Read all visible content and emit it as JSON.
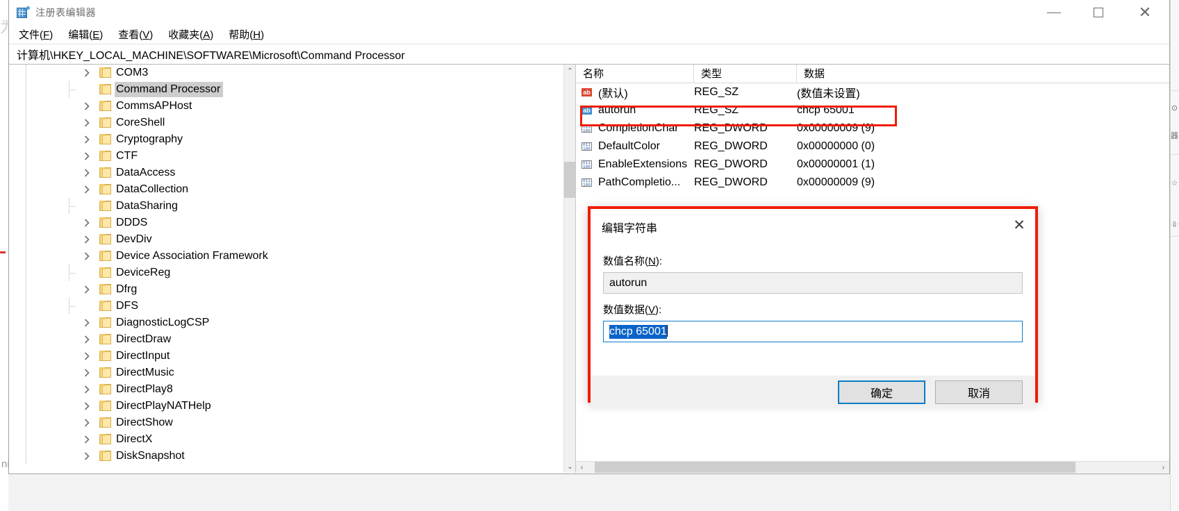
{
  "window": {
    "title": "注册表编辑器",
    "app_icon": "registry-editor-icon",
    "controls": {
      "minimize": "—",
      "maximize": "□",
      "close": "✕"
    }
  },
  "menubar": [
    {
      "label": "文件",
      "accel": "F"
    },
    {
      "label": "编辑",
      "accel": "E"
    },
    {
      "label": "查看",
      "accel": "V"
    },
    {
      "label": "收藏夹",
      "accel": "A"
    },
    {
      "label": "帮助",
      "accel": "H"
    }
  ],
  "address": "计算机\\HKEY_LOCAL_MACHINE\\SOFTWARE\\Microsoft\\Command Processor",
  "tree": {
    "items": [
      {
        "label": "COM3",
        "expandable": true,
        "selected": false
      },
      {
        "label": "Command Processor",
        "expandable": false,
        "selected": true
      },
      {
        "label": "CommsAPHost",
        "expandable": true,
        "selected": false
      },
      {
        "label": "CoreShell",
        "expandable": true,
        "selected": false
      },
      {
        "label": "Cryptography",
        "expandable": true,
        "selected": false
      },
      {
        "label": "CTF",
        "expandable": true,
        "selected": false
      },
      {
        "label": "DataAccess",
        "expandable": true,
        "selected": false
      },
      {
        "label": "DataCollection",
        "expandable": true,
        "selected": false
      },
      {
        "label": "DataSharing",
        "expandable": false,
        "selected": false
      },
      {
        "label": "DDDS",
        "expandable": true,
        "selected": false
      },
      {
        "label": "DevDiv",
        "expandable": true,
        "selected": false
      },
      {
        "label": "Device Association Framework",
        "expandable": true,
        "selected": false
      },
      {
        "label": "DeviceReg",
        "expandable": false,
        "selected": false
      },
      {
        "label": "Dfrg",
        "expandable": true,
        "selected": false
      },
      {
        "label": "DFS",
        "expandable": false,
        "selected": false
      },
      {
        "label": "DiagnosticLogCSP",
        "expandable": true,
        "selected": false
      },
      {
        "label": "DirectDraw",
        "expandable": true,
        "selected": false
      },
      {
        "label": "DirectInput",
        "expandable": true,
        "selected": false
      },
      {
        "label": "DirectMusic",
        "expandable": true,
        "selected": false
      },
      {
        "label": "DirectPlay8",
        "expandable": true,
        "selected": false
      },
      {
        "label": "DirectPlayNATHelp",
        "expandable": true,
        "selected": false
      },
      {
        "label": "DirectShow",
        "expandable": true,
        "selected": false
      },
      {
        "label": "DirectX",
        "expandable": true,
        "selected": false
      },
      {
        "label": "DiskSnapshot",
        "expandable": true,
        "selected": false
      }
    ]
  },
  "list": {
    "columns": [
      "名称",
      "类型",
      "数据"
    ],
    "rows": [
      {
        "name": "(默认)",
        "type": "REG_SZ",
        "data": "(数值未设置)",
        "icon": "string-value-icon",
        "icon_color": "#d9472f",
        "highlighted": false
      },
      {
        "name": "autorun",
        "type": "REG_SZ",
        "data": "chcp 65001",
        "icon": "string-value-icon",
        "icon_color": "#3f8fd0",
        "highlighted": true
      },
      {
        "name": "CompletionChar",
        "type": "REG_DWORD",
        "data": "0x00000009 (9)",
        "icon": "dword-value-icon",
        "icon_color": "#2a5fa8",
        "highlighted": false
      },
      {
        "name": "DefaultColor",
        "type": "REG_DWORD",
        "data": "0x00000000 (0)",
        "icon": "dword-value-icon",
        "icon_color": "#2a5fa8",
        "highlighted": false
      },
      {
        "name": "EnableExtensions",
        "type": "REG_DWORD",
        "data": "0x00000001 (1)",
        "icon": "dword-value-icon",
        "icon_color": "#2a5fa8",
        "highlighted": false
      },
      {
        "name": "PathCompletio...",
        "type": "REG_DWORD",
        "data": "0x00000009 (9)",
        "icon": "dword-value-icon",
        "icon_color": "#2a5fa8",
        "highlighted": false
      }
    ]
  },
  "dialog": {
    "title": "编辑字符串",
    "close_label": "✕",
    "name_label": "数值名称(N):",
    "name_label_plain": "数值名称",
    "name_accel": "N",
    "name_value": "autorun",
    "data_label": "数值数据(V):",
    "data_label_plain": "数值数据",
    "data_accel": "V",
    "data_value": "chcp 65001",
    "data_value_selected": true,
    "ok_label": "确定",
    "cancel_label": "取消",
    "highlight_color": "#f01b05",
    "focus_color": "#0a7cc8",
    "selection_color": "#0a64c8"
  },
  "behind": {
    "left_glyph": "为",
    "bottom_text": "nic  center)"
  },
  "scrollbars": {
    "tree_up": "⌃",
    "tree_down": "⌄",
    "list_left": "‹",
    "list_right": "›"
  },
  "right_sliver": {
    "items": [
      "⊙",
      "器",
      "☆",
      "⇩"
    ]
  }
}
